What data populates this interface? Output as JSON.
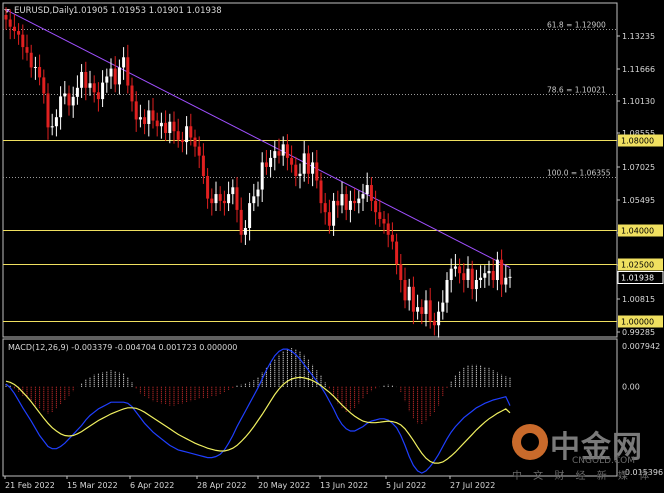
{
  "header": {
    "symbol": "EURUSD,Daily",
    "ohlc": "1.01905 1.01953 1.01901 1.01938",
    "collapse_icon": "triangle-down-icon"
  },
  "price_axis": {
    "ticks": [
      "1.13235",
      "1.11666",
      "1.10130",
      "1.08555",
      "1.07025",
      "1.05495",
      "1.03925",
      "1.02395",
      "1.00815",
      "0.99285"
    ],
    "current_price_label": "1.01938"
  },
  "horizontal_lines": [
    {
      "name": "fib-61-8",
      "label": "61.8 = 1.12900",
      "price": 1.129,
      "style": "dotted",
      "color": "#9a9a9a"
    },
    {
      "name": "fib-78-6",
      "label": "78.6 = 1.10021",
      "price": 1.10021,
      "style": "dotted",
      "color": "#9a9a9a"
    },
    {
      "name": "level-1-08",
      "label": "1.08000",
      "price": 1.08,
      "style": "solid",
      "color": "#f0e060"
    },
    {
      "name": "fib-100",
      "label": "100.0 = 1.06355",
      "price": 1.06355,
      "style": "dotted",
      "color": "#9a9a9a"
    },
    {
      "name": "level-1-04",
      "label": "1.04000",
      "price": 1.04,
      "style": "solid",
      "color": "#f0e060"
    },
    {
      "name": "level-1-025",
      "label": "1.02500",
      "price": 1.025,
      "style": "solid",
      "color": "#f0e060"
    },
    {
      "name": "level-1-00",
      "label": "1.00000",
      "price": 1.0,
      "style": "solid",
      "color": "#f0e060"
    }
  ],
  "trendline": {
    "color": "#a050ff",
    "from": {
      "bar": 0,
      "price": 1.1375
    },
    "to": {
      "bar": 120,
      "price": 1.0235
    }
  },
  "date_axis": [
    "21 Feb 2022",
    "15 Mar 2022",
    "6 Apr 2022",
    "28 Apr 2022",
    "20 May 2022",
    "13 Jun 2022",
    "5 Jul 2022",
    "27 Jul 2022"
  ],
  "macd": {
    "label": "MACD(12,26,9) -0.003379 -0.004704 0.001723 0.000000",
    "axis_ticks": [
      "0.007942",
      "0.00",
      "-0.015396"
    ],
    "ylim": [
      -0.0154,
      0.0079
    ],
    "histogram_color_up": "#ffffff",
    "histogram_color_down": "#e03030",
    "macd_line_color": "#1f3fff",
    "signal_line_color": "#f0f060"
  },
  "colors": {
    "background": "#000000",
    "bull_candle": "#ffffff",
    "bear_candle": "#e02020",
    "frame": "#c0c0c0",
    "text": "#d8d8d8",
    "current_price_box_bg": "#000000"
  },
  "watermark": {
    "brand_zh": "中金网",
    "site": "CNGOLD.COM",
    "slogan": "中 文 财 经 新 媒 体"
  },
  "chart_data": {
    "type": "candlestick",
    "symbol": "EURUSD",
    "timeframe": "Daily",
    "ylim": [
      0.9928,
      1.1405
    ],
    "close": [
      1.1332,
      1.13,
      1.1281,
      1.1265,
      1.121,
      1.1185,
      1.112,
      1.1122,
      1.1076,
      1.1005,
      1.0855,
      1.086,
      1.09,
      1.0992,
      1.1005,
      1.0952,
      1.099,
      1.103,
      1.11,
      1.103,
      1.105,
      1.101,
      1.098,
      1.1053,
      1.108,
      1.1115,
      1.1045,
      1.112,
      1.1165,
      1.104,
      1.097,
      1.089,
      1.09,
      1.087,
      1.093,
      1.0885,
      1.086,
      1.0875,
      1.083,
      1.088,
      1.0838,
      1.08,
      1.079,
      1.086,
      1.081,
      1.077,
      1.073,
      1.064,
      1.054,
      1.052,
      1.056,
      1.053,
      1.052,
      1.056,
      1.059,
      1.049,
      1.038,
      1.041,
      1.052,
      1.055,
      1.058,
      1.07,
      1.068,
      1.072,
      1.075,
      1.073,
      1.078,
      1.072,
      1.069,
      1.064,
      1.065,
      1.074,
      1.065,
      1.07,
      1.062,
      1.052,
      1.048,
      1.042,
      1.053,
      1.051,
      1.056,
      1.049,
      1.053,
      1.052,
      1.054,
      1.056,
      1.06,
      1.053,
      1.048,
      1.045,
      1.043,
      1.038,
      1.035,
      1.025,
      1.018,
      1.009,
      1.015,
      1.004,
      1.006,
      1.003,
      1.009,
      1.0,
      0.998,
      1.004,
      1.008,
      1.018,
      1.023,
      1.024,
      1.021,
      1.018,
      1.023,
      1.014,
      1.018,
      1.019,
      1.021,
      1.022,
      1.018,
      1.027,
      1.016,
      1.019,
      1.0194
    ],
    "macd_histogram": [
      0.0005,
      0.0002,
      -0.0004,
      -0.001,
      -0.0016,
      -0.0022,
      -0.0028,
      -0.0034,
      -0.004,
      -0.0044,
      -0.0048,
      -0.0046,
      -0.004,
      -0.0032,
      -0.0024,
      -0.0016,
      -0.0008,
      0.0,
      0.0006,
      0.0014,
      0.0018,
      0.0022,
      0.0024,
      0.0026,
      0.0028,
      0.003,
      0.0028,
      0.0026,
      0.0024,
      0.0018,
      0.0008,
      -0.0004,
      -0.0012,
      -0.0018,
      -0.0022,
      -0.0026,
      -0.0028,
      -0.003,
      -0.0032,
      -0.0034,
      -0.0034,
      -0.0032,
      -0.003,
      -0.0028,
      -0.0026,
      -0.0024,
      -0.0022,
      -0.002,
      -0.002,
      -0.0018,
      -0.0016,
      -0.0014,
      -0.001,
      -0.0006,
      -0.0002,
      0.0002,
      0.0004,
      0.0006,
      0.0008,
      0.0012,
      0.0018,
      0.0026,
      0.0034,
      0.0042,
      0.005,
      0.0058,
      0.0064,
      0.0068,
      0.007,
      0.0068,
      0.0064,
      0.0058,
      0.005,
      0.004,
      0.003,
      0.002,
      0.0008,
      -0.0004,
      -0.0016,
      -0.003,
      -0.004,
      -0.0046,
      -0.0044,
      -0.0038,
      -0.003,
      -0.0022,
      -0.0014,
      -0.0008,
      -0.0004,
      0.0,
      0.0002,
      0.0004,
      0.0002,
      0.0,
      -0.001,
      -0.0026,
      -0.0044,
      -0.0058,
      -0.0066,
      -0.0068,
      -0.0062,
      -0.0054,
      -0.0046,
      -0.0034,
      -0.0018,
      -0.0002,
      0.001,
      0.002,
      0.0028,
      0.0034,
      0.0038,
      0.004,
      0.004,
      0.0038,
      0.0036,
      0.0034,
      0.003,
      0.0026,
      0.0022,
      0.0019,
      0.0017
    ],
    "macd_line": [
      0.0005,
      -0.0002,
      -0.0012,
      -0.0025,
      -0.0038,
      -0.005,
      -0.0062,
      -0.0075,
      -0.0088,
      -0.0098,
      -0.0108,
      -0.0112,
      -0.0112,
      -0.0108,
      -0.0102,
      -0.0094,
      -0.0086,
      -0.0078,
      -0.007,
      -0.006,
      -0.0052,
      -0.0046,
      -0.004,
      -0.0036,
      -0.0032,
      -0.0028,
      -0.0028,
      -0.0028,
      -0.0028,
      -0.003,
      -0.0036,
      -0.0046,
      -0.0056,
      -0.0066,
      -0.0074,
      -0.0082,
      -0.0088,
      -0.0094,
      -0.01,
      -0.0106,
      -0.011,
      -0.0114,
      -0.0116,
      -0.0118,
      -0.012,
      -0.0122,
      -0.0124,
      -0.0126,
      -0.0128,
      -0.0128,
      -0.0126,
      -0.0122,
      -0.0114,
      -0.0102,
      -0.0088,
      -0.0072,
      -0.0058,
      -0.0044,
      -0.003,
      -0.0016,
      -0.0002,
      0.0014,
      0.003,
      0.0044,
      0.0056,
      0.0064,
      0.0068,
      0.0068,
      0.0064,
      0.0058,
      0.005,
      0.004,
      0.003,
      0.002,
      0.001,
      0.0,
      -0.0012,
      -0.0026,
      -0.004,
      -0.0056,
      -0.0068,
      -0.0076,
      -0.008,
      -0.008,
      -0.0076,
      -0.0072,
      -0.0066,
      -0.0062,
      -0.006,
      -0.0058,
      -0.0058,
      -0.006,
      -0.0066,
      -0.0074,
      -0.0088,
      -0.0106,
      -0.0126,
      -0.0142,
      -0.0152,
      -0.0156,
      -0.0152,
      -0.0144,
      -0.0134,
      -0.0122,
      -0.0108,
      -0.0094,
      -0.0082,
      -0.0072,
      -0.0064,
      -0.0056,
      -0.005,
      -0.0044,
      -0.0038,
      -0.0034,
      -0.003,
      -0.0027,
      -0.0024,
      -0.0022,
      -0.002,
      -0.0018,
      -0.0034
    ],
    "signal_line": [
      0.001,
      0.0008,
      0.0004,
      -0.0002,
      -0.001,
      -0.0018,
      -0.0027,
      -0.0037,
      -0.0047,
      -0.0057,
      -0.0066,
      -0.0074,
      -0.008,
      -0.0085,
      -0.0088,
      -0.0089,
      -0.0088,
      -0.0085,
      -0.0081,
      -0.0076,
      -0.0071,
      -0.0066,
      -0.0061,
      -0.0057,
      -0.0053,
      -0.0049,
      -0.0046,
      -0.0043,
      -0.004,
      -0.0038,
      -0.0038,
      -0.0039,
      -0.0042,
      -0.0046,
      -0.0051,
      -0.0056,
      -0.0061,
      -0.0066,
      -0.0071,
      -0.0076,
      -0.0081,
      -0.0086,
      -0.009,
      -0.0094,
      -0.0098,
      -0.0102,
      -0.0105,
      -0.0108,
      -0.0111,
      -0.0113,
      -0.0115,
      -0.0116,
      -0.0116,
      -0.0114,
      -0.0111,
      -0.0106,
      -0.0099,
      -0.0091,
      -0.0082,
      -0.0072,
      -0.0061,
      -0.005,
      -0.0038,
      -0.0026,
      -0.0014,
      -0.0004,
      0.0004,
      0.001,
      0.0014,
      0.0016,
      0.0017,
      0.0016,
      0.0014,
      0.0011,
      0.0007,
      0.0002,
      -0.0004,
      -0.001,
      -0.0017,
      -0.0025,
      -0.0033,
      -0.004,
      -0.0047,
      -0.0053,
      -0.0058,
      -0.0062,
      -0.0064,
      -0.0065,
      -0.0065,
      -0.0064,
      -0.0063,
      -0.0062,
      -0.0063,
      -0.0065,
      -0.0069,
      -0.0076,
      -0.0086,
      -0.0097,
      -0.0109,
      -0.012,
      -0.0129,
      -0.0135,
      -0.0138,
      -0.0138,
      -0.0136,
      -0.0131,
      -0.0125,
      -0.0118,
      -0.011,
      -0.0102,
      -0.0094,
      -0.0086,
      -0.0078,
      -0.0071,
      -0.0064,
      -0.0058,
      -0.0053,
      -0.0048,
      -0.0044,
      -0.004,
      -0.0047
    ]
  }
}
